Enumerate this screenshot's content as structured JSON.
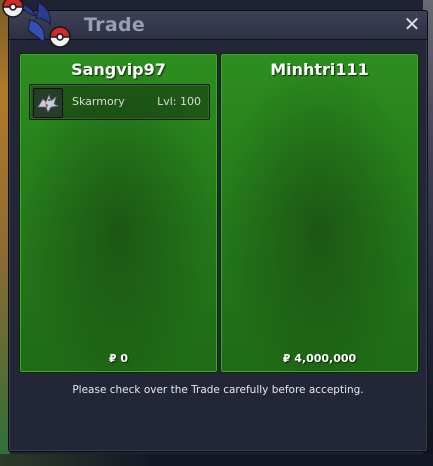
{
  "window": {
    "title": "Trade",
    "close_icon": "close-icon"
  },
  "left_panel": {
    "player_name": "Sangvip97",
    "items": [
      {
        "icon": "skarmory-icon",
        "name": "Skarmory",
        "level": "Lvl: 100"
      }
    ],
    "money": "₽ 0"
  },
  "right_panel": {
    "player_name": "Minhtri111",
    "items": [],
    "money": "₽ 4,000,000"
  },
  "notice": "Please check over the Trade carefully before accepting.",
  "colors": {
    "panel_green": "#2a8a1e",
    "window_bg": "#232637",
    "title_text": "#9a9eb0"
  }
}
